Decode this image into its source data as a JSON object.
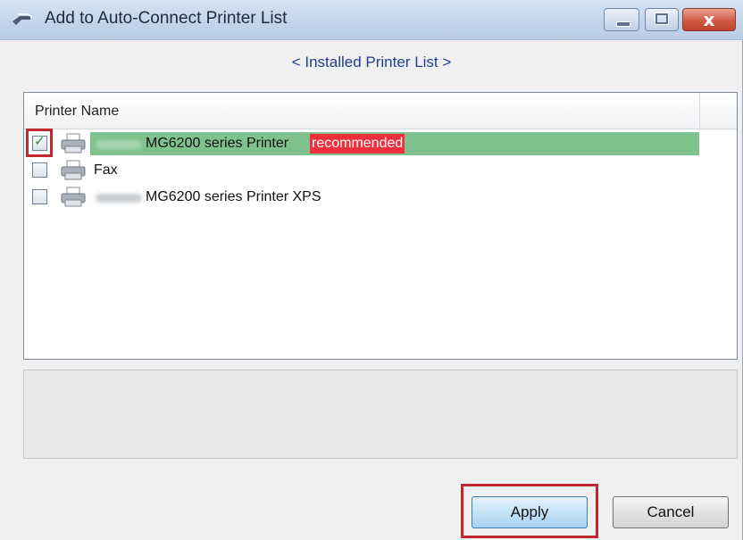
{
  "window": {
    "title": "Add to Auto-Connect Printer List",
    "close_glyph": "x"
  },
  "subtitle": "< Installed Printer List >",
  "list": {
    "column_header": "Printer Name",
    "rows": [
      {
        "name": "MG6200 series Printer",
        "badge": "recommended",
        "checked": true,
        "highlighted": true,
        "icon": "printer-icon"
      },
      {
        "name": "Fax",
        "checked": false,
        "highlighted": false,
        "icon": "fax-icon"
      },
      {
        "name": "MG6200 series Printer XPS",
        "checked": false,
        "highlighted": false,
        "icon": "printer-icon"
      }
    ]
  },
  "buttons": {
    "apply": "Apply",
    "cancel": "Cancel"
  },
  "colors": {
    "highlight": "#7fc28d",
    "badge": "#ef2f3c",
    "callout": "#c0282f"
  },
  "icons": [
    "app-icon",
    "minimize-icon",
    "maximize-icon",
    "close-icon",
    "printer-icon",
    "fax-icon",
    "checkmark-icon"
  ]
}
